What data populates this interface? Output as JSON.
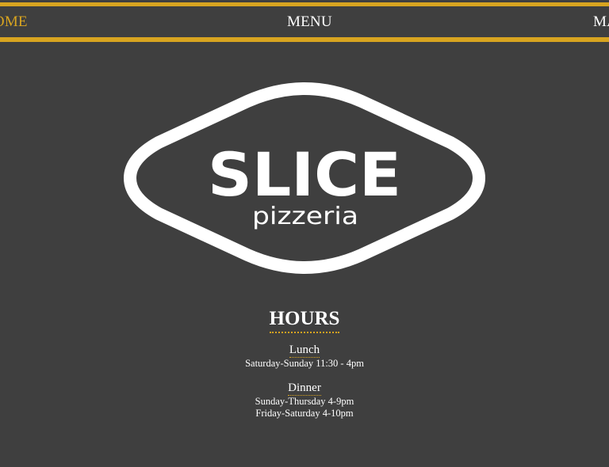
{
  "nav": {
    "items": [
      {
        "label": "HOME",
        "active": true
      },
      {
        "label": "MENU",
        "active": false
      },
      {
        "label": "MAP",
        "active": false
      }
    ],
    "accent_color": "#d8a420"
  },
  "logo": {
    "name": "SLICE",
    "tagline": "pizzeria"
  },
  "hours": {
    "title": "HOURS",
    "sections": [
      {
        "label": "Lunch",
        "lines": [
          "Saturday-Sunday 11:30 - 4pm"
        ]
      },
      {
        "label": "Dinner",
        "lines": [
          "Sunday-Thursday 4-9pm",
          "Friday-Saturday 4-10pm"
        ]
      }
    ]
  },
  "colors": {
    "background": "#3f3f3f",
    "accent": "#d8a420",
    "text": "#ffffff"
  }
}
